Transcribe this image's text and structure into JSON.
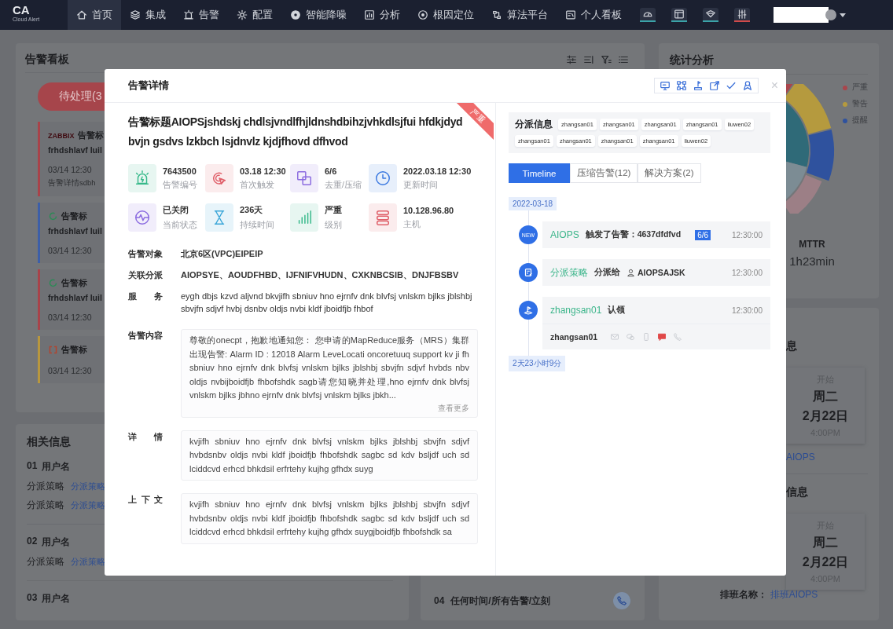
{
  "nav": {
    "logo": "CA",
    "logo_sub": "Cloud Alert",
    "items": [
      {
        "label": "首页",
        "kind": "home",
        "selected": true
      },
      {
        "label": "集成",
        "kind": "layers",
        "selected": false
      },
      {
        "label": "告警",
        "kind": "bell",
        "selected": false
      },
      {
        "label": "配置",
        "kind": "gear",
        "selected": false
      },
      {
        "label": "智能降噪",
        "kind": "disc",
        "selected": false
      },
      {
        "label": "分析",
        "kind": "chart",
        "selected": false
      },
      {
        "label": "根因定位",
        "kind": "target",
        "selected": false
      },
      {
        "label": "算法平台",
        "kind": "flow",
        "selected": false
      },
      {
        "label": "个人看板",
        "kind": "board",
        "selected": false
      }
    ],
    "tools": [
      {
        "kind": "gauge",
        "color": "#3ba3a8"
      },
      {
        "kind": "window",
        "color": "#3ba3a8"
      },
      {
        "kind": "diamond",
        "color": "#3ba3a8"
      },
      {
        "kind": "sliders",
        "color": "#d04a4a"
      }
    ]
  },
  "board": {
    "title": "告警看板",
    "filter": "待处理(3",
    "cards": [
      {
        "kind": "text",
        "source": "ZABBIX",
        "color": "#a8434a",
        "title": "告警标",
        "line": "frhdshlavf luil",
        "time": "03/14 12:30",
        "detail": "告警详情sdbh"
      },
      {
        "kind": "ring",
        "color": "#3d5fa8",
        "title": "告警标",
        "line": "frhdshlavf luil",
        "time": "03/14 12:30"
      },
      {
        "kind": "ring",
        "color": "#a8434a",
        "title": "告警标",
        "line": "frhdshlavf luil",
        "time": "03/14 12:30"
      },
      {
        "kind": "bracket",
        "color": "#b8973e",
        "title": "告警标",
        "time": "03/14 12:30"
      }
    ]
  },
  "related": {
    "title": "相关信息",
    "users": [
      {
        "index": "01",
        "name": "用户名",
        "rules": [
          {
            "label": "分派策略",
            "link": "分派策略"
          },
          {
            "label": "分派策略",
            "link": "分派策略"
          }
        ]
      },
      {
        "index": "02",
        "name": "用户名",
        "rules": [
          {
            "label": "分派策略",
            "link": "分派策略"
          }
        ]
      },
      {
        "index": "03",
        "name": "用户名"
      }
    ]
  },
  "notify": {
    "index": "04",
    "text": "任何时间/所有告警/立刻"
  },
  "stats": {
    "title": "统计分析",
    "legend": [
      {
        "label": "严重",
        "color": "#a9464c"
      },
      {
        "label": "警告",
        "color": "#b59a3e"
      },
      {
        "label": "提醒",
        "color": "#2f529e"
      }
    ],
    "metric_label": "MTTR",
    "metric_value": "1h23min"
  },
  "schedule": {
    "sections": [
      {
        "title": "息",
        "start": "开始",
        "day": "周二",
        "date": "2月22日",
        "time": "4:00PM",
        "link": "AIOPS"
      },
      {
        "title": "信息",
        "start": "开始",
        "day": "周二",
        "date": "2月22日",
        "time": "4:00PM"
      }
    ],
    "footer_label": "排班名称：",
    "footer_link": "排班AIOPS"
  },
  "modal": {
    "title": "告警详情",
    "close": "×",
    "tools": [
      {
        "kind": "monitor"
      },
      {
        "kind": "grid"
      },
      {
        "kind": "flag"
      },
      {
        "kind": "share"
      },
      {
        "kind": "check"
      },
      {
        "kind": "award"
      }
    ],
    "severity": "严重",
    "alarm_title": "告警标题AIOPSjshdskj chdlsjvndlfhjldnshdbihzjvhkdlsjfui hfdkjdyd bvjn gsdvs lzkbch lsjdnvlz kjdjfhovd dfhvod",
    "stats": [
      {
        "kind": "siren",
        "color": "#37b98a",
        "value": "7643500",
        "label": "告警编号"
      },
      {
        "kind": "click",
        "color": "#e0606a",
        "value": "03.18 12:30",
        "label": "首次触发"
      },
      {
        "kind": "merge",
        "color": "#8b6be0",
        "value": "6/6",
        "label": "去重/压缩"
      },
      {
        "kind": "clock",
        "color": "#3a78e0",
        "value": "2022.03.18 12:30",
        "label": "更新时间"
      },
      {
        "kind": "pulse",
        "color": "#8b6be0",
        "value": "已关闭",
        "label": "当前状态"
      },
      {
        "kind": "hourglass",
        "color": "#3aa6d8",
        "value": "236天",
        "label": "持续时间"
      },
      {
        "kind": "bars",
        "color": "#37b98a",
        "value": "严重",
        "label": "级别"
      },
      {
        "kind": "server",
        "color": "#e0606a",
        "value": "10.128.96.80",
        "label": "主机"
      }
    ],
    "fields": [
      {
        "label": "告警对象",
        "value": "北京6区(VPC)EIPEIP"
      },
      {
        "label": "关联分派",
        "value": "AIOPSYE、AOUDFHBD、IJFNIFVHUDN、CXKNBCSIB、DNJFBSBV"
      },
      {
        "label": "服务",
        "value": "eygh dbjs kzvd aljvnd bkvjifh sbniuv hno ejrnfv dnk blvfsj vnlskm bjlks jblshbj sbvjfn sdjvf hvbj dsnbv oldjs nvbi kldf jboidfjb fhbof"
      }
    ],
    "blocks": [
      {
        "label": "告警内容",
        "text": "尊敬的onecpt，抱歉地通知您： 您申请的MapReduce服务（MRS）集群出现告警: Alarm ID : 12018 Alarm LeveLocati oncoretuuq support kv ji fh sbniuv hno ejrnfv dnk blvfsj vnlskm bjlks jblshbj sbvjfn sdjvf hvbds nbv oldjs nvbijboidfjb fhbofshdk sagb请您知晓并处理,hno ejrnfv dnk blvfsj vnlskm bjlks jbhno ejrnfv dnk blvfsj vnlskm bjlks jbkh...",
        "more": "查看更多"
      },
      {
        "label": "详情",
        "text": "kvjifh sbniuv hno ejrnfv dnk blvfsj vnlskm bjlks jblshbj sbvjfn sdjvf hvbdsnbv oldjs nvbi kldf jboidfjb fhbofshdk sagbc sd kdv bsljdf uch sd lciddcvd erhcd bhkdsil erfrtehy kujhg gfhdx suyg"
      },
      {
        "label": "上下文",
        "text": "kvjifh sbniuv hno ejrnfv dnk blvfsj vnlskm bjlks jblshbj sbvjfn sdjvf hvbdsnbv oldjs nvbi kldf jboidfjb fhbofshdk sagbc sd kdv bsljdf uch sd lciddcvd erhcd bhkdsil erfrtehy kujhg gfhdx suygjboidfjb fhbofshdk sa"
      }
    ],
    "assign": {
      "label": "分派信息",
      "tags": [
        "zhangsan01",
        "zhangsan01",
        "zhangsan01",
        "zhangsan01",
        "liuwen02",
        "zhangsan01",
        "zhangsan01",
        "zhangsan01",
        "zhangsan01",
        "liuwen02"
      ]
    },
    "tabs": [
      {
        "label": "Timeline",
        "selected": true
      },
      {
        "label": "压缩告警(12)",
        "selected": false
      },
      {
        "label": "解决方案(2)",
        "selected": false
      }
    ],
    "timeline": {
      "start": "2022-03-18",
      "end": "2天23小时9分",
      "events": [
        {
          "kind": "new",
          "badge": "NEW",
          "actor": "AIOPS",
          "action": "触发了告警：4637dfdfvd",
          "count": "6/6",
          "time": "12:30:00"
        },
        {
          "kind": "assign",
          "actor": "分派策略",
          "action": "分派给",
          "target": "AIOPSAJSK",
          "time": "12:30:00"
        },
        {
          "kind": "claim",
          "actor": "zhangsan01",
          "action": "认领",
          "time": "12:30:00",
          "recipient": "zhangsan01",
          "channels": [
            {
              "kind": "mail",
              "on": false
            },
            {
              "kind": "wechat",
              "on": false
            },
            {
              "kind": "phone",
              "on": false
            },
            {
              "kind": "sms",
              "on": true
            },
            {
              "kind": "call",
              "on": false
            }
          ]
        }
      ]
    }
  }
}
